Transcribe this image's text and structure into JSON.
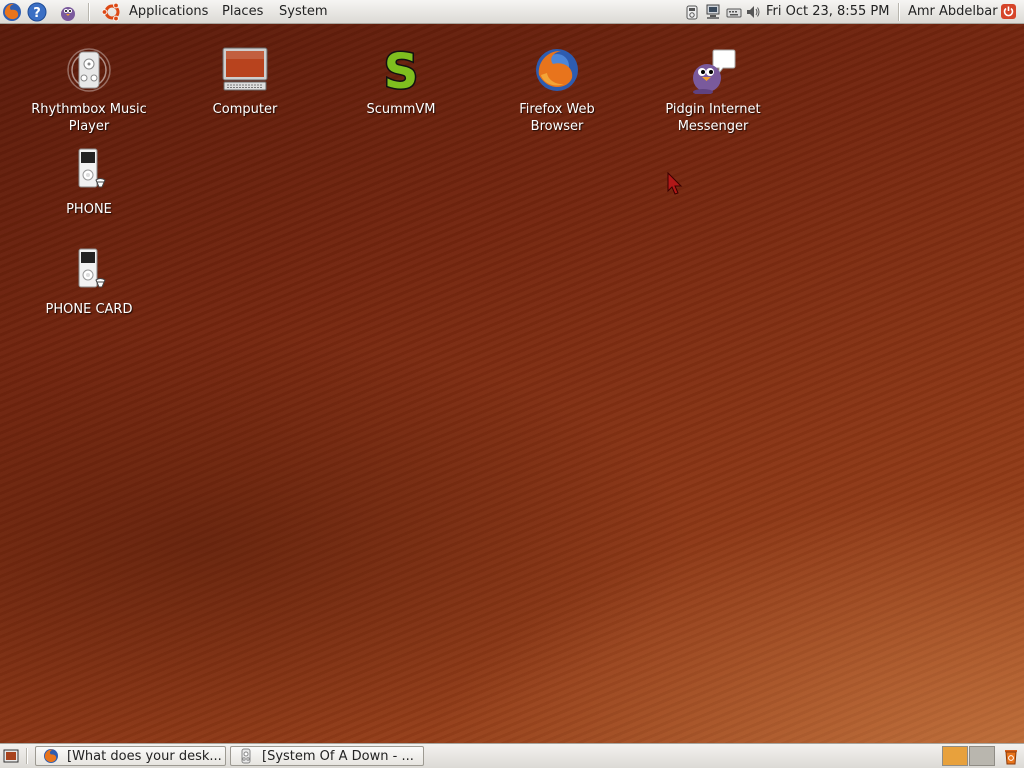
{
  "top_panel": {
    "launchers": [
      {
        "icon": "firefox-icon"
      },
      {
        "icon": "help-icon"
      },
      {
        "icon": "pidgin-icon"
      }
    ],
    "menus": {
      "applications": "Applications",
      "places": "Places",
      "system": "System"
    },
    "tray_icons": [
      "phone-device-icon",
      "network-icon",
      "keyboard-icon",
      "volume-icon"
    ],
    "clock": "Fri Oct 23,  8:55 PM",
    "user": "Amr Abdelbar"
  },
  "desktop": {
    "icons": [
      {
        "label": "Rhythmbox Music Player",
        "icon": "rhythmbox-icon"
      },
      {
        "label": "Computer",
        "icon": "computer-icon"
      },
      {
        "label": "ScummVM",
        "icon": "scummvm-icon"
      },
      {
        "label": "Firefox Web Browser",
        "icon": "firefox-icon"
      },
      {
        "label": "Pidgin Internet Messenger",
        "icon": "pidgin-icon"
      },
      {
        "label": "PHONE",
        "icon": "media-player-device-icon"
      },
      {
        "label": "PHONE CARD",
        "icon": "media-player-device-icon"
      }
    ]
  },
  "bottom_panel": {
    "tasks": [
      {
        "label": "[What does your desk...",
        "icon": "firefox-icon"
      },
      {
        "label": "[System Of A Down - ...",
        "icon": "rhythmbox-icon"
      }
    ],
    "workspaces": [
      {
        "active": true
      },
      {
        "active": false
      }
    ]
  },
  "colors": {
    "desktop_base": "#74260f",
    "panel": "#e8e6e1",
    "workspace_active": "#e8a13c"
  }
}
